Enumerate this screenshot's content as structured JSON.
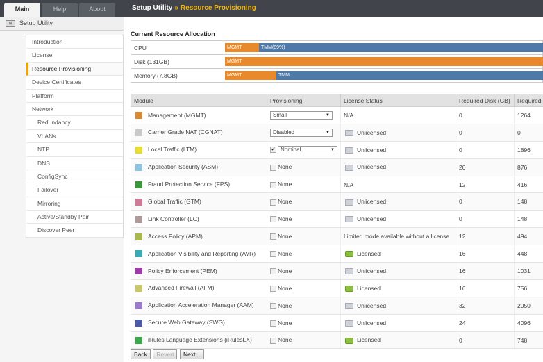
{
  "tabs": [
    "Main",
    "Help",
    "About"
  ],
  "breadcrumb": {
    "root": "Setup Utility",
    "separator": "»",
    "current": "Resource Provisioning"
  },
  "nav": {
    "title": "Setup Utility",
    "items": [
      {
        "label": "Introduction",
        "sub": false,
        "active": false
      },
      {
        "label": "License",
        "sub": false,
        "active": false
      },
      {
        "label": "Resource Provisioning",
        "sub": false,
        "active": true
      },
      {
        "label": "Device Certificates",
        "sub": false,
        "active": false
      },
      {
        "label": "Platform",
        "sub": false,
        "active": false
      },
      {
        "label": "Network",
        "sub": false,
        "active": false
      },
      {
        "label": "Redundancy",
        "sub": true,
        "active": false
      },
      {
        "label": "VLANs",
        "sub": true,
        "active": false
      },
      {
        "label": "NTP",
        "sub": true,
        "active": false
      },
      {
        "label": "DNS",
        "sub": true,
        "active": false
      },
      {
        "label": "ConfigSync",
        "sub": true,
        "active": false
      },
      {
        "label": "Failover",
        "sub": true,
        "active": false
      },
      {
        "label": "Mirroring",
        "sub": true,
        "active": false
      },
      {
        "label": "Active/Standby Pair",
        "sub": true,
        "active": false
      },
      {
        "label": "Discover Peer",
        "sub": true,
        "active": false
      }
    ]
  },
  "allocation": {
    "title": "Current Resource Allocation",
    "rows": [
      {
        "label": "CPU",
        "segments": [
          {
            "text": "MGMT",
            "kind": "mgmt",
            "fraction": 0.107
          },
          {
            "text": "TMM(89%)",
            "kind": "tmm",
            "fraction": 0.893
          }
        ]
      },
      {
        "label": "Disk (131GB)",
        "segments": [
          {
            "text": "MGMT",
            "kind": "mgmt",
            "fraction": 1.0
          }
        ]
      },
      {
        "label": "Memory (7.8GB)",
        "segments": [
          {
            "text": "MGMT",
            "kind": "mgmt",
            "fraction": 0.162
          },
          {
            "text": "TMM",
            "kind": "tmm",
            "fraction": 0.84
          }
        ]
      }
    ],
    "colors": {
      "mgmt": "#e8892c",
      "tmm": "#4f7aa8"
    }
  },
  "modules": {
    "headers": [
      "Module",
      "Provisioning",
      "License Status",
      "Required Disk (GB)",
      "Required M"
    ],
    "rows": [
      {
        "name": "Management (MGMT)",
        "color": "#d9892f",
        "prov": "Small",
        "prov_type": "select",
        "checked": false,
        "lic": "N/A",
        "lic_icon": "none",
        "disk": "0",
        "mem": "1264"
      },
      {
        "name": "Carrier Grade NAT (CGNAT)",
        "color": "#c9c9c9",
        "prov": "Disabled",
        "prov_type": "select",
        "checked": false,
        "lic": "Unlicensed",
        "lic_icon": "unlicensed",
        "disk": "0",
        "mem": "0"
      },
      {
        "name": "Local Traffic (LTM)",
        "color": "#e6dc2a",
        "prov": "Nominal",
        "prov_type": "checkselect",
        "checked": true,
        "lic": "Unlicensed",
        "lic_icon": "unlicensed",
        "disk": "0",
        "mem": "1896"
      },
      {
        "name": "Application Security (ASM)",
        "color": "#8ec3e0",
        "prov": "None",
        "prov_type": "check",
        "checked": false,
        "lic": "Unlicensed",
        "lic_icon": "unlicensed",
        "disk": "20",
        "mem": "876"
      },
      {
        "name": "Fraud Protection Service (FPS)",
        "color": "#3a9a3a",
        "prov": "None",
        "prov_type": "check",
        "checked": false,
        "lic": "N/A",
        "lic_icon": "none",
        "disk": "12",
        "mem": "416"
      },
      {
        "name": "Global Traffic (GTM)",
        "color": "#d07a9a",
        "prov": "None",
        "prov_type": "check",
        "checked": false,
        "lic": "Unlicensed",
        "lic_icon": "unlicensed",
        "disk": "0",
        "mem": "148"
      },
      {
        "name": "Link Controller (LC)",
        "color": "#b09a9a",
        "prov": "None",
        "prov_type": "check",
        "checked": false,
        "lic": "Unlicensed",
        "lic_icon": "unlicensed",
        "disk": "0",
        "mem": "148"
      },
      {
        "name": "Access Policy (APM)",
        "color": "#a9b84a",
        "prov": "None",
        "prov_type": "check",
        "checked": false,
        "lic": "Limited mode available without a license",
        "lic_icon": "none",
        "disk": "12",
        "mem": "494"
      },
      {
        "name": "Application Visibility and Reporting (AVR)",
        "color": "#3aaab8",
        "prov": "None",
        "prov_type": "check",
        "checked": false,
        "lic": "Licensed",
        "lic_icon": "licensed",
        "disk": "16",
        "mem": "448"
      },
      {
        "name": "Policy Enforcement (PEM)",
        "color": "#a03aa8",
        "prov": "None",
        "prov_type": "check",
        "checked": false,
        "lic": "Unlicensed",
        "lic_icon": "unlicensed",
        "disk": "16",
        "mem": "1031"
      },
      {
        "name": "Advanced Firewall (AFM)",
        "color": "#c8c86a",
        "prov": "None",
        "prov_type": "check",
        "checked": false,
        "lic": "Licensed",
        "lic_icon": "licensed",
        "disk": "16",
        "mem": "756"
      },
      {
        "name": "Application Acceleration Manager (AAM)",
        "color": "#9a7ad0",
        "prov": "None",
        "prov_type": "check",
        "checked": false,
        "lic": "Unlicensed",
        "lic_icon": "unlicensed",
        "disk": "32",
        "mem": "2050"
      },
      {
        "name": "Secure Web Gateway (SWG)",
        "color": "#4a5aa8",
        "prov": "None",
        "prov_type": "check",
        "checked": false,
        "lic": "Unlicensed",
        "lic_icon": "unlicensed",
        "disk": "24",
        "mem": "4096"
      },
      {
        "name": "iRules Language Extensions (iRulesLX)",
        "color": "#3aa84a",
        "prov": "None",
        "prov_type": "check",
        "checked": false,
        "lic": "Licensed",
        "lic_icon": "licensed",
        "disk": "0",
        "mem": "748"
      }
    ]
  },
  "buttons": {
    "back": "Back",
    "revert": "Revert",
    "next": "Next..."
  }
}
